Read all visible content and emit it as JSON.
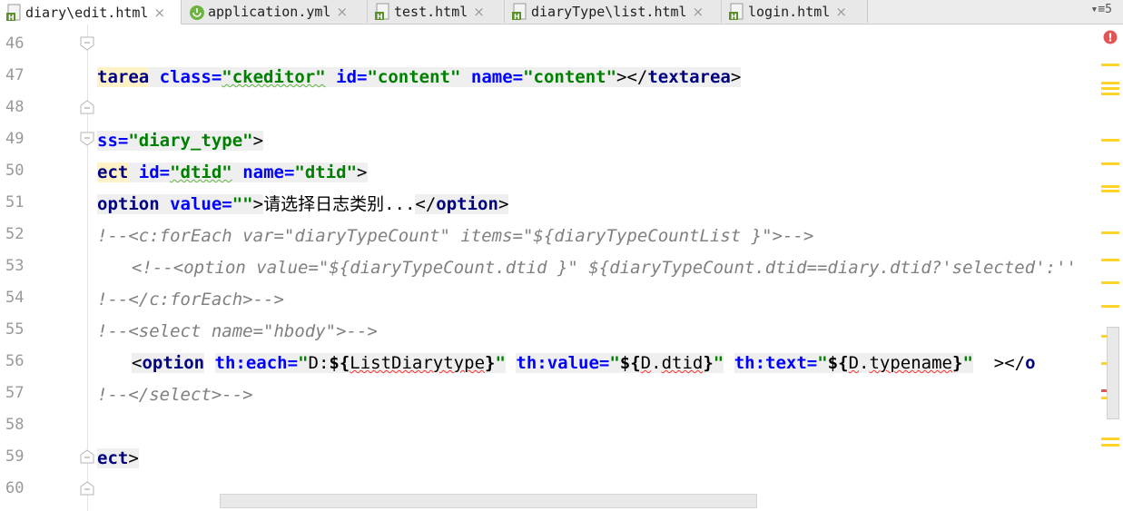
{
  "tabs": [
    {
      "name": "diary\\edit.html",
      "icon": "html-file-icon",
      "active": true
    },
    {
      "name": "application.yml",
      "icon": "spring-config-icon",
      "active": false
    },
    {
      "name": "test.html",
      "icon": "html-file-icon",
      "active": false
    },
    {
      "name": "diaryType\\list.html",
      "icon": "html-file-icon",
      "active": false
    },
    {
      "name": "login.html",
      "icon": "html-file-icon",
      "active": false
    }
  ],
  "tab_close_glyph": "×",
  "tab_menu_label": "▾≡5",
  "line_numbers": [
    "46",
    "47",
    "48",
    "49",
    "50",
    "51",
    "52",
    "53",
    "54",
    "55",
    "56",
    "57",
    "58",
    "59",
    "60"
  ],
  "code": {
    "l47": {
      "t1": "tarea",
      "t2": " ",
      "a1": "class=",
      "s1": "\"ckeditor\"",
      "t3": " ",
      "a2": "id=",
      "s2": "\"content\"",
      "t4": " ",
      "a3": "name=",
      "s3": "\"content\"",
      "t5": "></",
      "tag2": "textarea",
      "t6": ">"
    },
    "l49": {
      "a1": "ss=",
      "s1": "\"diary_type\"",
      "t1": ">"
    },
    "l50": {
      "tag": "ect",
      "sp": " ",
      "a1": "id=",
      "s1": "\"dtid\"",
      "sp2": " ",
      "a2": "name=",
      "s2": "\"dtid\"",
      "t1": ">"
    },
    "l51": {
      "tag": "option",
      "sp": " ",
      "a1": "value=",
      "s1": "\"\"",
      "t1": ">",
      "txt": "请选择日志类别...",
      "t2": "</",
      "tag2": "option",
      "t3": ">"
    },
    "l52": "!--<c:forEach var=\"diaryTypeCount\" items=\"${diaryTypeCountList }\">-->",
    "l53": "<!--<option value=\"${diaryTypeCount.dtid }\" ${diaryTypeCount.dtid==diary.dtid?'selected':''",
    "l54": "!--</c:forEach>-->",
    "l55": "!--<select name=\"hbody\">-->",
    "l56": {
      "p1": "<",
      "tag": "option",
      "sp": " ",
      "a1": "th:each=",
      "q1": "\"",
      "e1": "D:",
      "d1": "${",
      "v1": "ListDiarytype",
      "d2": "}",
      "q2": "\"",
      "sp2": " ",
      "a2": "th:value=",
      "q3": "\"",
      "d3": "${",
      "v2": "D",
      "dot": ".",
      "v3": "dtid",
      "d4": "}",
      "q4": "\"",
      "sp3": " ",
      "a3": "th:text=",
      "q5": "\"",
      "d5": "${",
      "v4": "D",
      "dot2": ".",
      "v5": "typename",
      "d6": "}",
      "q6": "\"",
      "sp4": "  ",
      "t1": "></",
      "tag2": "o"
    },
    "l57": "!--</select>-->",
    "l59": {
      "tag": "ect",
      "t1": ">"
    }
  },
  "error_indicator": "!"
}
